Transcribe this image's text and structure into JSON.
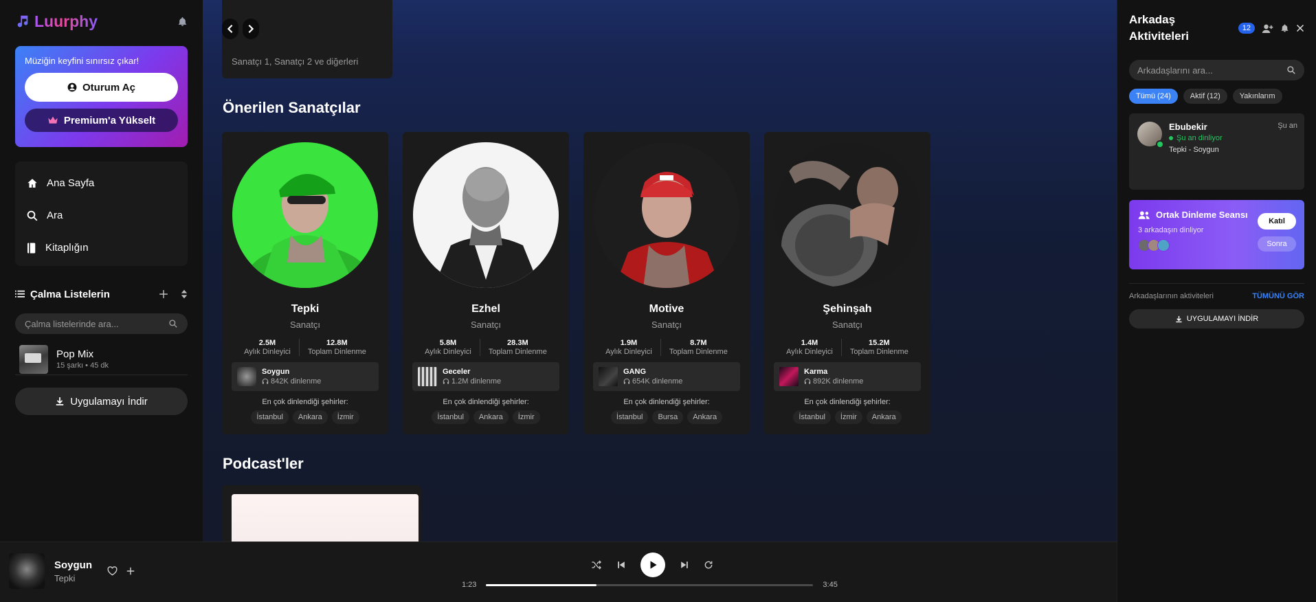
{
  "brand": {
    "name": "Luurphy"
  },
  "premium": {
    "text": "Müziğin keyfini sınırsız çıkar!",
    "login_label": "Oturum Aç",
    "upgrade_label": "Premium'a Yükselt"
  },
  "nav": {
    "items": [
      {
        "label": "Ana Sayfa",
        "icon": "home-icon"
      },
      {
        "label": "Ara",
        "icon": "search-icon"
      },
      {
        "label": "Kitaplığın",
        "icon": "library-icon"
      }
    ]
  },
  "playlists": {
    "title": "Çalma Listelerin",
    "search_placeholder": "Çalma listelerinde ara...",
    "items": [
      {
        "name": "Pop Mix",
        "meta": "15 şarkı • 45 dk"
      }
    ],
    "download_label": "Uygulamayı İndir"
  },
  "main": {
    "top_card_artists": "Sanatçı 1, Sanatçı 2 ve diğerleri",
    "artists_title": "Önerilen Sanatçılar",
    "podcasts_title": "Podcast'ler",
    "monthly_label": "Aylık Dinleyici",
    "total_label": "Toplam Dinlenme",
    "cities_label": "En çok dinlendiği şehirler:",
    "artists": [
      {
        "name": "Tepki",
        "role": "Sanatçı",
        "monthly": "2.5M",
        "total": "12.8M",
        "song": "Soygun",
        "plays": "842K dinlenme",
        "cities": [
          "İstanbul",
          "Ankara",
          "İzmir"
        ]
      },
      {
        "name": "Ezhel",
        "role": "Sanatçı",
        "monthly": "5.8M",
        "total": "28.3M",
        "song": "Geceler",
        "plays": "1.2M dinlenme",
        "cities": [
          "İstanbul",
          "Ankara",
          "İzmir"
        ]
      },
      {
        "name": "Motive",
        "role": "Sanatçı",
        "monthly": "1.9M",
        "total": "8.7M",
        "song": "GANG",
        "plays": "654K dinlenme",
        "cities": [
          "İstanbul",
          "Bursa",
          "Ankara"
        ]
      },
      {
        "name": "Şehinşah",
        "role": "Sanatçı",
        "monthly": "1.4M",
        "total": "15.2M",
        "song": "Karma",
        "plays": "892K dinlenme",
        "cities": [
          "İstanbul",
          "İzmir",
          "Ankara"
        ]
      }
    ]
  },
  "friends": {
    "title": "Arkadaş Aktiviteleri",
    "badge": "12",
    "search_placeholder": "Arkadaşlarını ara...",
    "tabs": [
      "Tümü (24)",
      "Aktif (12)",
      "Yakınlarım"
    ],
    "activity": {
      "name": "Ebubekir",
      "status": "Şu an dinliyor",
      "track": "Tepki - Soygun",
      "time": "Şu an"
    },
    "session": {
      "title": "Ortak Dinleme Seansı",
      "subtitle": "3 arkadaşın dinliyor",
      "join_label": "Katıl",
      "later_label": "Sonra"
    },
    "footer_label": "Arkadaşlarının aktiviteleri",
    "see_all": "TÜMÜNÜ GÖR",
    "download_label": "UYGULAMAYI İNDİR"
  },
  "player": {
    "title": "Soygun",
    "artist": "Tepki",
    "current_time": "1:23",
    "duration": "3:45",
    "progress": 0.337
  },
  "colors": {
    "accent": "#3b82f6",
    "purple": "#7c3aed",
    "online": "#22c55e"
  }
}
